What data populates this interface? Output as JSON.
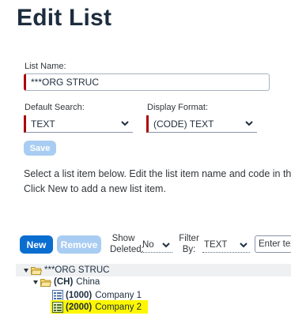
{
  "page": {
    "title": "Edit List"
  },
  "form": {
    "list_name_label": "List Name:",
    "list_name_value": "***ORG STRUC",
    "default_search_label": "Default Search:",
    "default_search_value": "TEXT",
    "display_format_label": "Display Format:",
    "display_format_value": "(CODE) TEXT",
    "save_label": "Save"
  },
  "instructions": {
    "line1": "Select a list item below. Edit the list item name and code in the",
    "line2": "Click New to add a new list item."
  },
  "toolbar": {
    "new_label": "New",
    "remove_label": "Remove",
    "show_deleted_line1": "Show",
    "show_deleted_line2": "Deleted:",
    "show_deleted_value": "No",
    "filter_by_line1": "Filter",
    "filter_by_line2": "By:",
    "filter_by_value": "TEXT",
    "filter_placeholder": "Enter tex"
  },
  "tree": {
    "root": {
      "label": "***ORG STRUC"
    },
    "child": {
      "code": "(CH)",
      "label": "China"
    },
    "leaves": [
      {
        "code": "(1000)",
        "label": "Company 1"
      },
      {
        "code": "(2000)",
        "label": "Company 2"
      }
    ]
  },
  "colors": {
    "primary": "#0a6ed1",
    "required": "#aa0808",
    "selected_highlight": "#fff700"
  }
}
